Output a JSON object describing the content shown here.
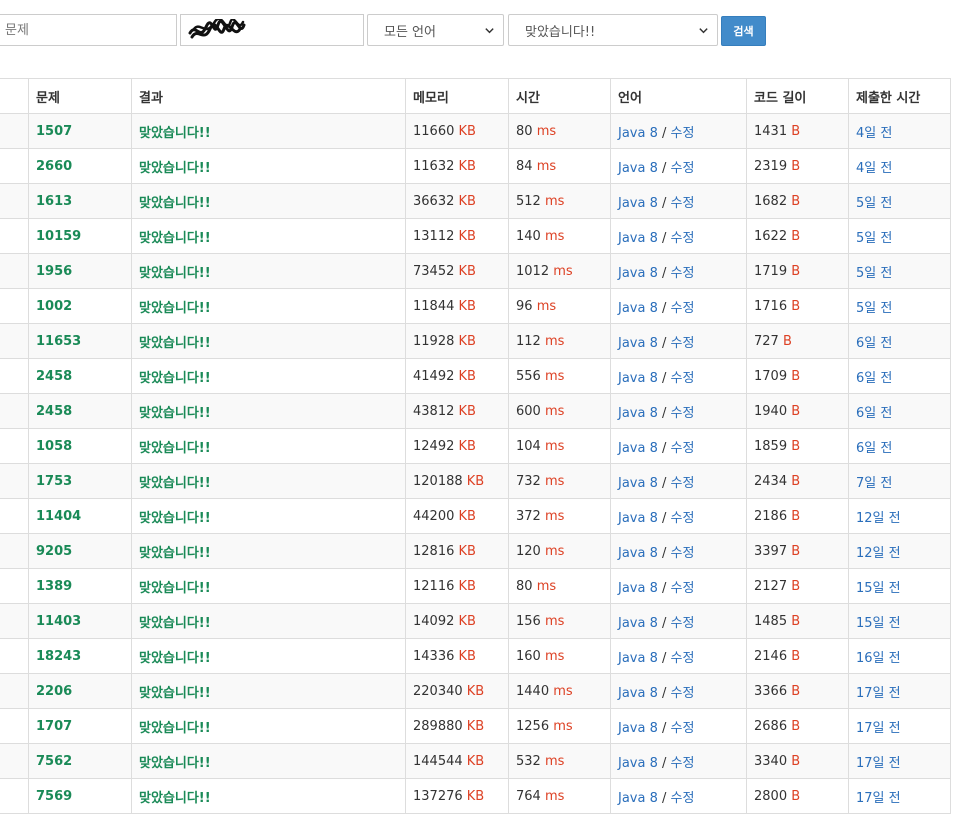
{
  "search": {
    "problem_placeholder": "문제",
    "user_value": "",
    "language_selected": "모든 언어",
    "result_selected": "맞았습니다!!",
    "search_label": "검색"
  },
  "table": {
    "headers": [
      "",
      "문제",
      "결과",
      "메모리",
      "시간",
      "언어",
      "코드 길이",
      "제출한 시간"
    ],
    "units": {
      "memory": "KB",
      "time": "ms",
      "code": "B"
    },
    "rows": [
      {
        "problem": "1507",
        "result": "맞았습니다!!",
        "memory": "11660",
        "time": "80",
        "language": "Java 8",
        "sep": "/",
        "edit": "수정",
        "code": "1431",
        "submitted": "4일 전"
      },
      {
        "problem": "2660",
        "result": "맞았습니다!!",
        "memory": "11632",
        "time": "84",
        "language": "Java 8",
        "sep": "/",
        "edit": "수정",
        "code": "2319",
        "submitted": "4일 전"
      },
      {
        "problem": "1613",
        "result": "맞았습니다!!",
        "memory": "36632",
        "time": "512",
        "language": "Java 8",
        "sep": "/",
        "edit": "수정",
        "code": "1682",
        "submitted": "5일 전"
      },
      {
        "problem": "10159",
        "result": "맞았습니다!!",
        "memory": "13112",
        "time": "140",
        "language": "Java 8",
        "sep": "/",
        "edit": "수정",
        "code": "1622",
        "submitted": "5일 전"
      },
      {
        "problem": "1956",
        "result": "맞았습니다!!",
        "memory": "73452",
        "time": "1012",
        "language": "Java 8",
        "sep": "/",
        "edit": "수정",
        "code": "1719",
        "submitted": "5일 전"
      },
      {
        "problem": "1002",
        "result": "맞았습니다!!",
        "memory": "11844",
        "time": "96",
        "language": "Java 8",
        "sep": "/",
        "edit": "수정",
        "code": "1716",
        "submitted": "5일 전"
      },
      {
        "problem": "11653",
        "result": "맞았습니다!!",
        "memory": "11928",
        "time": "112",
        "language": "Java 8",
        "sep": "/",
        "edit": "수정",
        "code": "727",
        "submitted": "6일 전"
      },
      {
        "problem": "2458",
        "result": "맞았습니다!!",
        "memory": "41492",
        "time": "556",
        "language": "Java 8",
        "sep": "/",
        "edit": "수정",
        "code": "1709",
        "submitted": "6일 전"
      },
      {
        "problem": "2458",
        "result": "맞았습니다!!",
        "memory": "43812",
        "time": "600",
        "language": "Java 8",
        "sep": "/",
        "edit": "수정",
        "code": "1940",
        "submitted": "6일 전"
      },
      {
        "problem": "1058",
        "result": "맞았습니다!!",
        "memory": "12492",
        "time": "104",
        "language": "Java 8",
        "sep": "/",
        "edit": "수정",
        "code": "1859",
        "submitted": "6일 전"
      },
      {
        "problem": "1753",
        "result": "맞았습니다!!",
        "memory": "120188",
        "time": "732",
        "language": "Java 8",
        "sep": "/",
        "edit": "수정",
        "code": "2434",
        "submitted": "7일 전"
      },
      {
        "problem": "11404",
        "result": "맞았습니다!!",
        "memory": "44200",
        "time": "372",
        "language": "Java 8",
        "sep": "/",
        "edit": "수정",
        "code": "2186",
        "submitted": "12일 전"
      },
      {
        "problem": "9205",
        "result": "맞았습니다!!",
        "memory": "12816",
        "time": "120",
        "language": "Java 8",
        "sep": "/",
        "edit": "수정",
        "code": "3397",
        "submitted": "12일 전"
      },
      {
        "problem": "1389",
        "result": "맞았습니다!!",
        "memory": "12116",
        "time": "80",
        "language": "Java 8",
        "sep": "/",
        "edit": "수정",
        "code": "2127",
        "submitted": "15일 전"
      },
      {
        "problem": "11403",
        "result": "맞았습니다!!",
        "memory": "14092",
        "time": "156",
        "language": "Java 8",
        "sep": "/",
        "edit": "수정",
        "code": "1485",
        "submitted": "15일 전"
      },
      {
        "problem": "18243",
        "result": "맞았습니다!!",
        "memory": "14336",
        "time": "160",
        "language": "Java 8",
        "sep": "/",
        "edit": "수정",
        "code": "2146",
        "submitted": "16일 전"
      },
      {
        "problem": "2206",
        "result": "맞았습니다!!",
        "memory": "220340",
        "time": "1440",
        "language": "Java 8",
        "sep": "/",
        "edit": "수정",
        "code": "3366",
        "submitted": "17일 전"
      },
      {
        "problem": "1707",
        "result": "맞았습니다!!",
        "memory": "289880",
        "time": "1256",
        "language": "Java 8",
        "sep": "/",
        "edit": "수정",
        "code": "2686",
        "submitted": "17일 전"
      },
      {
        "problem": "7562",
        "result": "맞았습니다!!",
        "memory": "144544",
        "time": "532",
        "language": "Java 8",
        "sep": "/",
        "edit": "수정",
        "code": "3340",
        "submitted": "17일 전"
      },
      {
        "problem": "7569",
        "result": "맞았습니다!!",
        "memory": "137276",
        "time": "764",
        "language": "Java 8",
        "sep": "/",
        "edit": "수정",
        "code": "2800",
        "submitted": "17일 전"
      }
    ]
  },
  "colors": {
    "accepted": "#1a8a57",
    "unit": "#dd4124",
    "link": "#2a6ebb",
    "button": "#428bca"
  },
  "icons": {
    "select_arrow": "chevron-down-icon"
  }
}
